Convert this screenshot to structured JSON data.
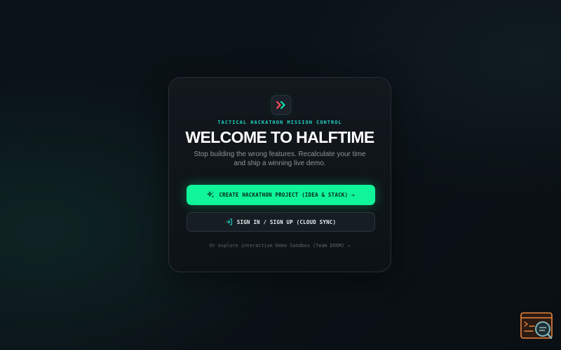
{
  "hero": {
    "eyebrow": "TACTICAL HACKATHON MISSION CONTROL",
    "title": "WELCOME TO HALFTIME",
    "subtitle": "Stop building the wrong features. Recalculate your time and ship a winning live demo."
  },
  "actions": {
    "create_project_label": "CREATE HACKATHON PROJECT (IDEA & STACK) →",
    "sign_in_label": "SIGN IN / SIGN UP (CLOUD SYNC)",
    "demo_link_label": "Or explore interactive Demo Sandbox (Team DOOM) →"
  },
  "icons": {
    "logo": "fast-forward-chevrons-icon",
    "create": "sparkles-icon",
    "sign_in": "login-arrow-icon",
    "corner_widget": "terminal-search-icon"
  },
  "colors": {
    "accent_green": "#10f59a",
    "accent_teal": "#22d3c5",
    "logo_red": "#ff4b5c",
    "widget_orange": "#e8843c",
    "background": "#0b1217"
  }
}
